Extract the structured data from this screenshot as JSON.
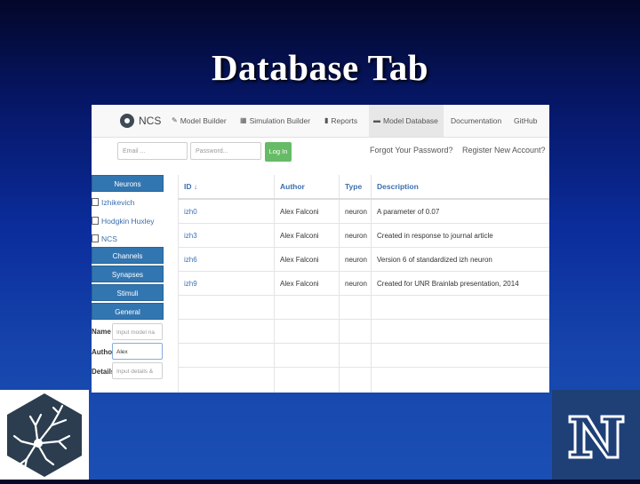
{
  "slide": {
    "title": "Database Tab"
  },
  "app": {
    "brand": "NCS",
    "nav": [
      {
        "label": "Model Builder",
        "icon": "pencil-icon",
        "glyph": "✎"
      },
      {
        "label": "Simulation Builder",
        "icon": "grid-icon",
        "glyph": "▦"
      },
      {
        "label": "Reports",
        "icon": "bar-chart-icon",
        "glyph": "▮"
      },
      {
        "label": "Model Database",
        "icon": "database-icon",
        "glyph": "▬",
        "active": true
      },
      {
        "label": "Documentation"
      },
      {
        "label": "GitHub"
      }
    ],
    "login": {
      "email_placeholder": "Email ...",
      "password_placeholder": "Password...",
      "login_button": "Log In",
      "forgot_link": "Forgot Your Password?",
      "register_link": "Register New Account?"
    },
    "sidebar": {
      "sections": [
        "Neurons",
        "Channels",
        "Synapses",
        "Stimuli",
        "General"
      ],
      "neuron_options": [
        "Izhikevich",
        "Hodgkin Huxley",
        "NCS"
      ],
      "fields": [
        {
          "label": "Name",
          "placeholder": "Input model na",
          "value": ""
        },
        {
          "label": "Author",
          "placeholder": "",
          "value": "Alex"
        },
        {
          "label": "Details",
          "placeholder": "Input details &",
          "value": ""
        }
      ]
    },
    "table": {
      "headers": [
        "ID ↓",
        "Author",
        "Type",
        "Description"
      ],
      "rows": [
        [
          "izh0",
          "Alex Falconi",
          "neuron",
          "A parameter of 0.07"
        ],
        [
          "izh3",
          "Alex Falconi",
          "neuron",
          "Created in response to journal article"
        ],
        [
          "izh6",
          "Alex Falconi",
          "neuron",
          "Version 6 of standardized izh neuron"
        ],
        [
          "izh9",
          "Alex Falconi",
          "neuron",
          "Created for UNR Brainlab presentation, 2014"
        ]
      ]
    }
  },
  "logos": {
    "left": "neuron-logo-icon",
    "right": "unr-n-logo-icon",
    "right_bg": "#1f3f77"
  }
}
